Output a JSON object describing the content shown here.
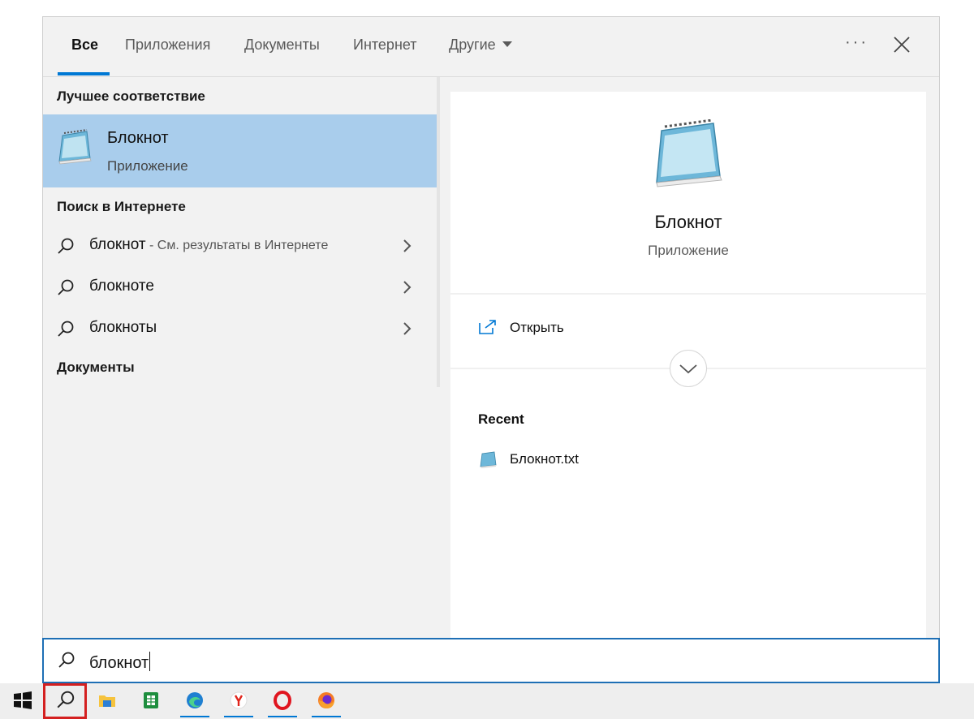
{
  "tabs": [
    {
      "label": "Все",
      "active": true
    },
    {
      "label": "Приложения"
    },
    {
      "label": "Документы"
    },
    {
      "label": "Интернет"
    },
    {
      "label": "Другие"
    }
  ],
  "toolbar": {
    "more_label": "···",
    "close_icon": "close-icon"
  },
  "left": {
    "best_match_heading": "Лучшее соответствие",
    "best_match": {
      "title": "Блокнот",
      "subtitle": "Приложение",
      "icon": "notepad-icon"
    },
    "web_heading": "Поиск в Интернете",
    "web_results": [
      {
        "query": "блокнот",
        "hint": " - См. результаты в Интернете"
      },
      {
        "query": "блокноте",
        "hint": ""
      },
      {
        "query": "блокноты",
        "hint": ""
      }
    ],
    "documents_heading": "Документы"
  },
  "preview": {
    "title": "Блокнот",
    "subtitle": "Приложение",
    "open_label": "Открыть",
    "recent_heading": "Recent",
    "recent_items": [
      {
        "name": "Блокнот.txt",
        "icon": "notepad-icon"
      }
    ]
  },
  "search": {
    "value": "блокнот"
  },
  "taskbar": {
    "items": [
      "windows-start-icon",
      "search-icon",
      "file-explorer-icon",
      "spreadsheet-app-icon",
      "edge-icon",
      "yandex-browser-icon",
      "opera-icon",
      "firefox-icon"
    ]
  },
  "colors": {
    "accent": "#0078d4",
    "selection": "#a9cdec",
    "highlight_border": "#d42020"
  }
}
